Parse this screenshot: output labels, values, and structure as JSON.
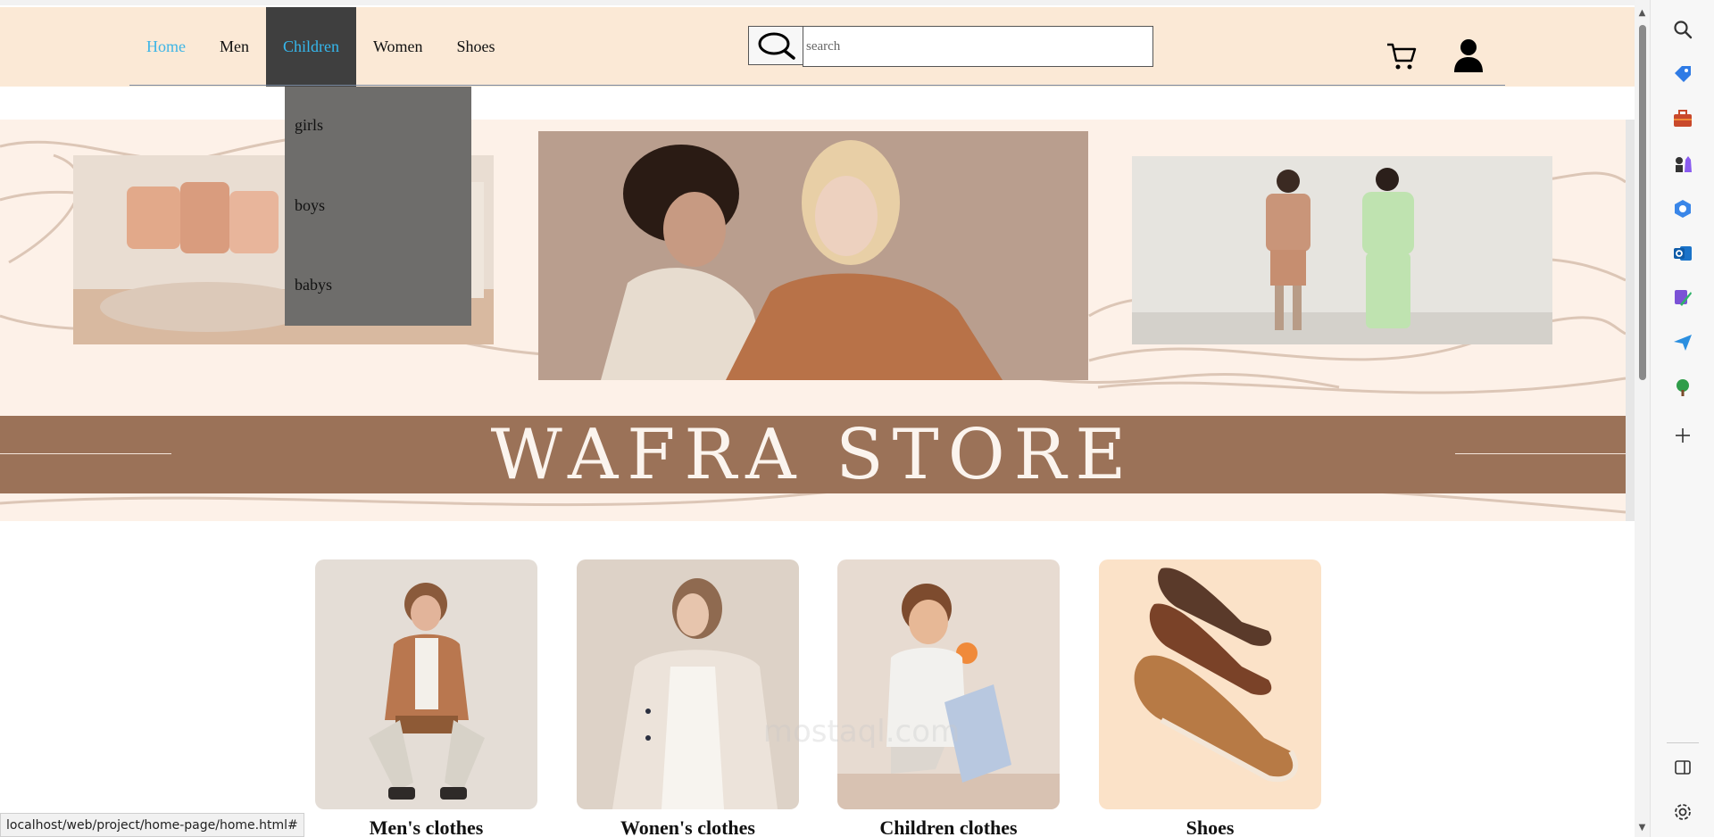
{
  "nav": {
    "items": [
      {
        "label": "Home"
      },
      {
        "label": "Men"
      },
      {
        "label": "Children"
      },
      {
        "label": "Women"
      },
      {
        "label": "Shoes"
      }
    ]
  },
  "search": {
    "placeholder": "search"
  },
  "dropdown": {
    "items": [
      {
        "label": "girls"
      },
      {
        "label": "boys"
      },
      {
        "label": "babys"
      }
    ]
  },
  "hero": {
    "title": "WAFRA STORE"
  },
  "categories": [
    {
      "label": "Men's clothes"
    },
    {
      "label": "Wonen's clothes"
    },
    {
      "label": "Children clothes"
    },
    {
      "label": "Shoes"
    }
  ],
  "statusbar": {
    "url": "localhost/web/project/home-page/home.html#"
  },
  "watermark": {
    "text": "mostaql.com"
  },
  "colors": {
    "header_bg": "#fbe9d6",
    "nav_active": "#3db5e6",
    "dropdown_bg": "#6e6d6b",
    "banner_bg": "#9b7258",
    "hero_bg": "#fdf1e8"
  },
  "icons": [
    "search-icon",
    "cart-icon",
    "user-icon",
    "edge-search-icon",
    "edge-tag-icon",
    "edge-briefcase-icon",
    "edge-chess-icon",
    "edge-copilot-icon",
    "edge-outlook-icon",
    "edge-designer-icon",
    "edge-send-icon",
    "edge-tree-icon",
    "edge-add-icon",
    "edge-sidebar-toggle-icon",
    "edge-settings-icon"
  ]
}
